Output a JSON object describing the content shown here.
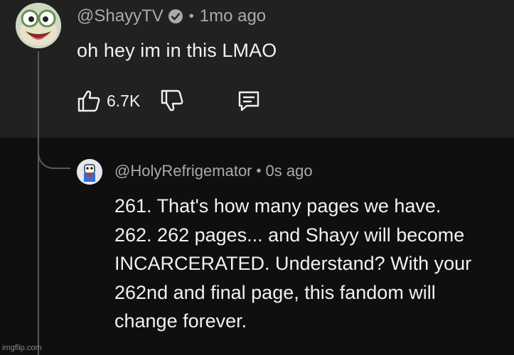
{
  "top_comment": {
    "handle": "@ShayyTV",
    "separator": "•",
    "timestamp": "1mo ago",
    "text": "oh hey im in this LMAO",
    "like_count": "6.7K",
    "avatar_icon": "frog-avatar",
    "verified_icon": "verified-checkmark-icon"
  },
  "reply": {
    "handle": "@HolyRefrigemator",
    "separator": "•",
    "timestamp": "0s ago",
    "lines": [
      "261. That's how many pages we have.",
      "262. 262 pages... and Shayy will become",
      "INCARCERATED. Understand? With your",
      "262nd and final page, this fandom will",
      "change forever."
    ],
    "avatar_icon": "character-avatar"
  },
  "watermark": "imgflip.com",
  "colors": {
    "top_background": "#212121",
    "page_background": "#0f0f0f",
    "primary_text": "#f1f1f1",
    "secondary_text": "#aaaaaa"
  }
}
